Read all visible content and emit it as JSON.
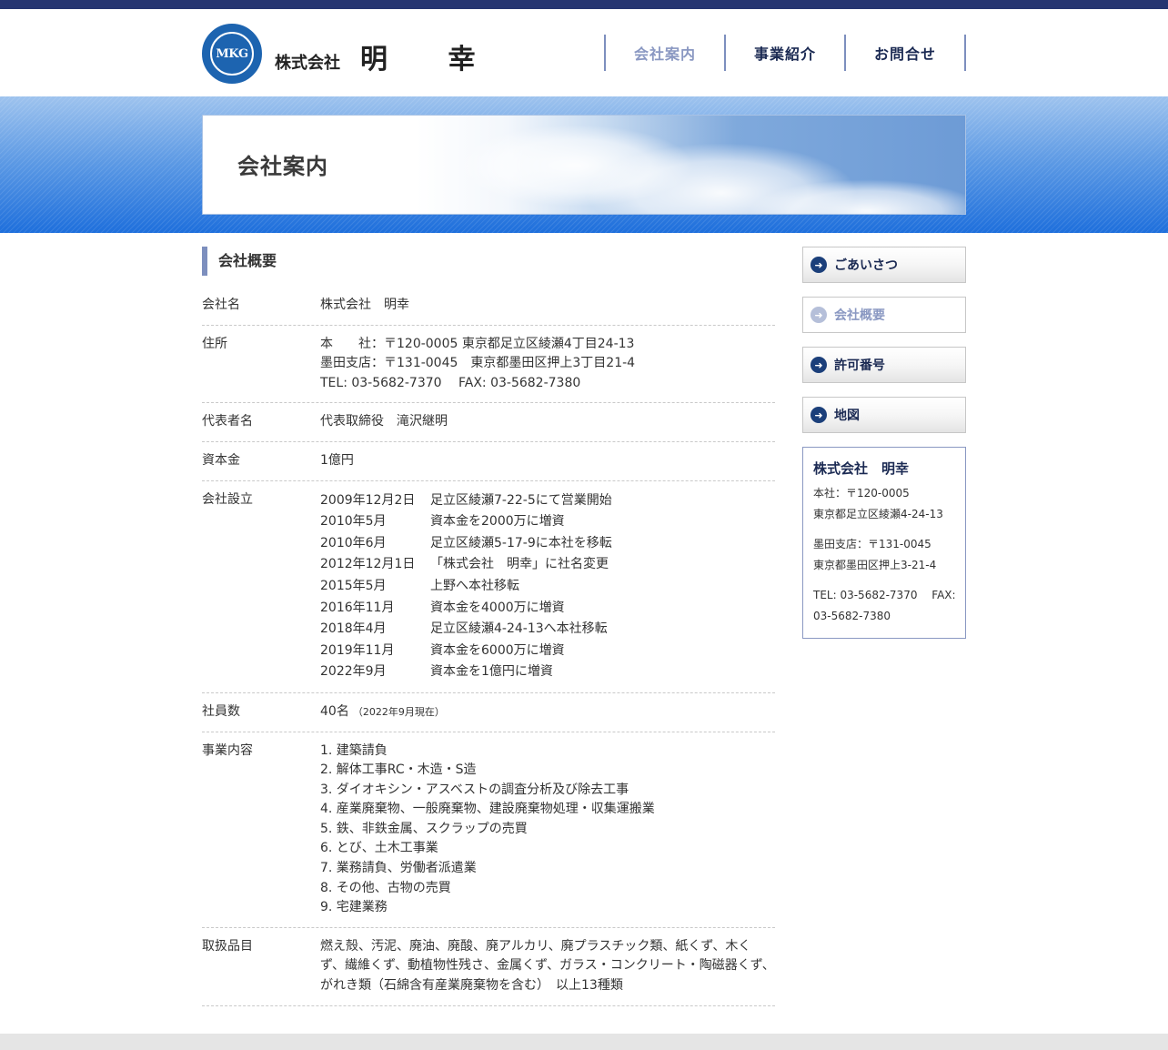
{
  "header": {
    "logo_mark": "MKG",
    "logo_prefix": "株式会社",
    "logo_name": "明 幸",
    "nav": [
      {
        "label": "会社案内",
        "active": true
      },
      {
        "label": "事業紹介",
        "active": false
      },
      {
        "label": "お問合せ",
        "active": false
      }
    ]
  },
  "hero": {
    "title": "会社案内"
  },
  "main": {
    "heading": "会社概要",
    "rows": {
      "name": {
        "label": "会社名",
        "value": "株式会社　明幸"
      },
      "address": {
        "label": "住所",
        "lines": [
          "本　　社：〒120-0005 東京都足立区綾瀬4丁目24-13",
          "墨田支店：〒131-0045　東京都墨田区押上3丁目21-4",
          "TEL: 03-5682-7370　 FAX: 03-5682-7380"
        ]
      },
      "representative": {
        "label": "代表者名",
        "value": "代表取締役　滝沢継明"
      },
      "capital": {
        "label": "資本金",
        "value": "1億円"
      },
      "history": {
        "label": "会社設立",
        "items": [
          {
            "date": "2009年12月2日",
            "event": "足立区綾瀬7-22-5にて営業開始"
          },
          {
            "date": "2010年5月",
            "event": "資本金を2000万に増資"
          },
          {
            "date": "2010年6月",
            "event": "足立区綾瀬5-17-9に本社を移転"
          },
          {
            "date": "2012年12月1日",
            "event": "「株式会社　明幸」に社名変更"
          },
          {
            "date": "2015年5月",
            "event": "上野へ本社移転"
          },
          {
            "date": "2016年11月",
            "event": "資本金を4000万に増資"
          },
          {
            "date": "2018年4月",
            "event": "足立区綾瀬4-24-13へ本社移転"
          },
          {
            "date": "2019年11月",
            "event": "資本金を6000万に増資"
          },
          {
            "date": "2022年9月",
            "event": "資本金を1億円に増資"
          }
        ]
      },
      "employees": {
        "label": "社員数",
        "value": "40名",
        "note": "（2022年9月現在）"
      },
      "business": {
        "label": "事業内容",
        "items": [
          "1. 建築請負",
          "2. 解体工事RC・木造・S造",
          "3. ダイオキシン・アスベストの調査分析及び除去工事",
          "4. 産業廃棄物、一般廃棄物、建設廃棄物処理・収集運搬業",
          "5. 鉄、非鉄金属、スクラップの売買",
          "6. とび、土木工事業",
          "7. 業務請負、労働者派遣業",
          "8. その他、古物の売買",
          "9. 宅建業務"
        ]
      },
      "items_handled": {
        "label": "取扱品目",
        "value": "燃え殻、汚泥、廃油、廃酸、廃アルカリ、廃プラスチック類、紙くず、木くず、繊維くず、動植物性残さ、金属くず、ガラス・コンクリート・陶磁器くず、がれき類（石綿含有産業廃棄物を含む）　以上13種類"
      }
    }
  },
  "sidebar": {
    "buttons": [
      {
        "label": "ごあいさつ",
        "active": false
      },
      {
        "label": "会社概要",
        "active": true
      },
      {
        "label": "許可番号",
        "active": false
      },
      {
        "label": "地図",
        "active": false
      }
    ],
    "info": {
      "title": "株式会社　明幸",
      "head_office_1": "本社：〒120-0005",
      "head_office_2": "東京都足立区綾瀬4-24-13",
      "branch_1": "墨田支店：〒131-0045",
      "branch_2": "東京都墨田区押上3-21-4",
      "contact": "TEL: 03-5682-7370　 FAX: 03-5682-7380"
    }
  },
  "colors": {
    "topbar": "#263571",
    "nav_text": "#1b2a53",
    "accent": "#7d8fbe"
  }
}
